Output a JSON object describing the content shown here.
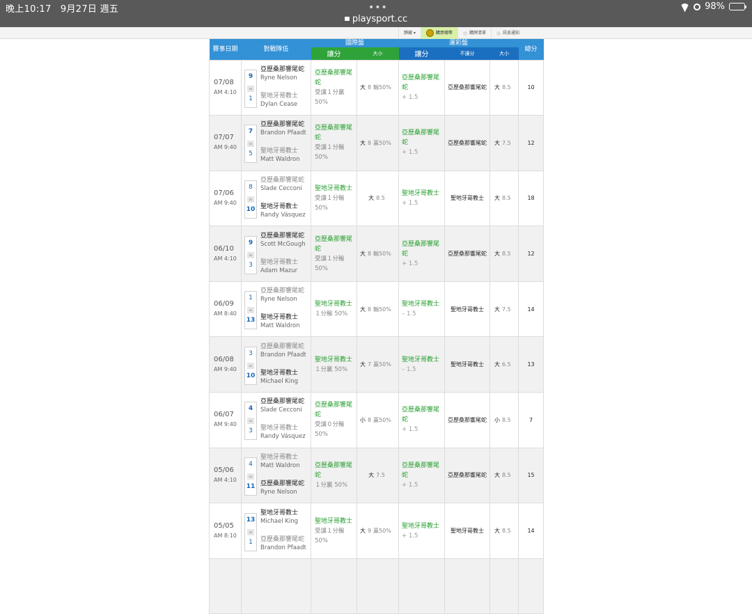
{
  "status": {
    "time": "晚上10:17",
    "date": "9月27日 週五",
    "battery": "98%",
    "url": "playsport.cc"
  },
  "sitebar": {
    "tabs": [
      {
        "label": "靜藏 ▾",
        "active": false
      },
      {
        "label": "購買噱幣",
        "active": true
      },
      {
        "label": "購牌清單",
        "active": false
      },
      {
        "label": "訊息通知",
        "active": false
      }
    ]
  },
  "table": {
    "headers": {
      "date": "賽事日期",
      "team": "對戰隊伍",
      "intl": "國際盤",
      "sl": "運彩盤",
      "total": "總分",
      "intl_spread": "讓分",
      "intl_ou": "大小",
      "sl_spread": "讓分",
      "sl_nospread": "不讓分",
      "sl_ou": "大小"
    },
    "rows": [
      {
        "md": "07/08",
        "time": "AM 4:10",
        "s1": "9",
        "s2": "1",
        "t1": "亞歷桑那響尾蛇",
        "p1": "Ryne Nelson",
        "t2": "聖地牙哥教士",
        "p2": "Dylan Cease",
        "w": 1,
        "intl_pick": "亞歷桑那響尾蛇",
        "intl_res": "受讓１分贏50%",
        "ou": "大",
        "ou_line": "8",
        "ou_res": "輸50%",
        "sl_pick": "亞歷桑那響尾蛇",
        "sl_spread": "+ 1.5",
        "nosp": "亞歷桑那響尾蛇",
        "ou2": "大",
        "ou2_line": "8.5",
        "total": "10"
      },
      {
        "md": "07/07",
        "time": "AM 9:40",
        "s1": "7",
        "s2": "5",
        "t1": "亞歷桑那響尾蛇",
        "p1": "Brandon Pfaadt",
        "t2": "聖地牙哥教士",
        "p2": "Matt Waldron",
        "w": 1,
        "intl_pick": "亞歷桑那響尾蛇",
        "intl_res": "受讓１分輸50%",
        "ou": "大",
        "ou_line": "8",
        "ou_res": "贏50%",
        "sl_pick": "亞歷桑那響尾蛇",
        "sl_spread": "+ 1.5",
        "nosp": "亞歷桑那響尾蛇",
        "ou2": "大",
        "ou2_line": "7.5",
        "total": "12"
      },
      {
        "md": "07/06",
        "time": "AM 9:40",
        "s1": "8",
        "s2": "10",
        "t1": "亞歷桑那響尾蛇",
        "p1": "Slade Cecconi",
        "t2": "聖地牙哥教士",
        "p2": "Randy Vásquez",
        "w": 2,
        "intl_pick": "聖地牙哥教士",
        "intl_res": "受讓１分輸50%",
        "ou": "大",
        "ou_line": "8.5",
        "ou_res": "",
        "sl_pick": "聖地牙哥教士",
        "sl_spread": "+ 1.5",
        "nosp": "聖地牙哥教士",
        "ou2": "大",
        "ou2_line": "8.5",
        "total": "18"
      },
      {
        "md": "06/10",
        "time": "AM 4:10",
        "s1": "9",
        "s2": "3",
        "t1": "亞歷桑那響尾蛇",
        "p1": "Scott McGough",
        "t2": "聖地牙哥教士",
        "p2": "Adam Mazur",
        "w": 1,
        "intl_pick": "亞歷桑那響尾蛇",
        "intl_res": "受讓１分輸50%",
        "ou": "大",
        "ou_line": "8",
        "ou_res": "輸50%",
        "sl_pick": "亞歷桑那響尾蛇",
        "sl_spread": "+ 1.5",
        "nosp": "亞歷桑那響尾蛇",
        "ou2": "大",
        "ou2_line": "8.5",
        "total": "12"
      },
      {
        "md": "06/09",
        "time": "AM 8:40",
        "s1": "1",
        "s2": "13",
        "t1": "亞歷桑那響尾蛇",
        "p1": "Ryne Nelson",
        "t2": "聖地牙哥教士",
        "p2": "Matt Waldron",
        "w": 2,
        "intl_pick": "聖地牙哥教士",
        "intl_res": "１分輸 50%",
        "ou": "大",
        "ou_line": "8",
        "ou_res": "輸50%",
        "sl_pick": "聖地牙哥教士",
        "sl_spread": "– 1.5",
        "nosp": "聖地牙哥教士",
        "ou2": "大",
        "ou2_line": "7.5",
        "total": "14"
      },
      {
        "md": "06/08",
        "time": "AM 9:40",
        "s1": "3",
        "s2": "10",
        "t1": "亞歷桑那響尾蛇",
        "p1": "Brandon Pfaadt",
        "t2": "聖地牙哥教士",
        "p2": "Michael King",
        "w": 2,
        "intl_pick": "聖地牙哥教士",
        "intl_res": "１分贏 50%",
        "ou": "大",
        "ou_line": "7",
        "ou_res": "贏50%",
        "sl_pick": "聖地牙哥教士",
        "sl_spread": "– 1.5",
        "nosp": "聖地牙哥教士",
        "ou2": "大",
        "ou2_line": "6.5",
        "total": "13"
      },
      {
        "md": "06/07",
        "time": "AM 9:40",
        "s1": "4",
        "s2": "3",
        "t1": "亞歷桑那響尾蛇",
        "p1": "Slade Cecconi",
        "t2": "聖地牙哥教士",
        "p2": "Randy Vásquez",
        "w": 1,
        "intl_pick": "亞歷桑那響尾蛇",
        "intl_res": "受讓０分輸50%",
        "ou": "小",
        "ou_line": "8",
        "ou_res": "贏50%",
        "sl_pick": "亞歷桑那響尾蛇",
        "sl_spread": "+ 1.5",
        "nosp": "亞歷桑那響尾蛇",
        "ou2": "小",
        "ou2_line": "8.5",
        "total": "7"
      },
      {
        "md": "05/06",
        "time": "AM 4:10",
        "s1": "4",
        "s2": "11",
        "t1": "聖地牙哥教士",
        "p1": "Matt Waldron",
        "t2": "亞歷桑那響尾蛇",
        "p2": "Ryne Nelson",
        "w": 2,
        "intl_pick": "亞歷桑那響尾蛇",
        "intl_res": "１分贏 50%",
        "ou": "大",
        "ou_line": "7.5",
        "ou_res": "",
        "sl_pick": "亞歷桑那響尾蛇",
        "sl_spread": "+ 1.5",
        "nosp": "亞歷桑那響尾蛇",
        "ou2": "大",
        "ou2_line": "8.5",
        "total": "15"
      },
      {
        "md": "05/05",
        "time": "AM 8:10",
        "s1": "13",
        "s2": "1",
        "t1": "聖地牙哥教士",
        "p1": "Michael King",
        "t2": "亞歷桑那響尾蛇",
        "p2": "Brandon Pfaadt",
        "w": 1,
        "intl_pick": "聖地牙哥教士",
        "intl_res": "受讓１分輸50%",
        "ou": "大",
        "ou_line": "9",
        "ou_res": "贏50%",
        "sl_pick": "聖地牙哥教士",
        "sl_spread": "+ 1.5",
        "nosp": "聖地牙哥教士",
        "ou2": "大",
        "ou2_line": "8.5",
        "total": "14"
      }
    ]
  }
}
